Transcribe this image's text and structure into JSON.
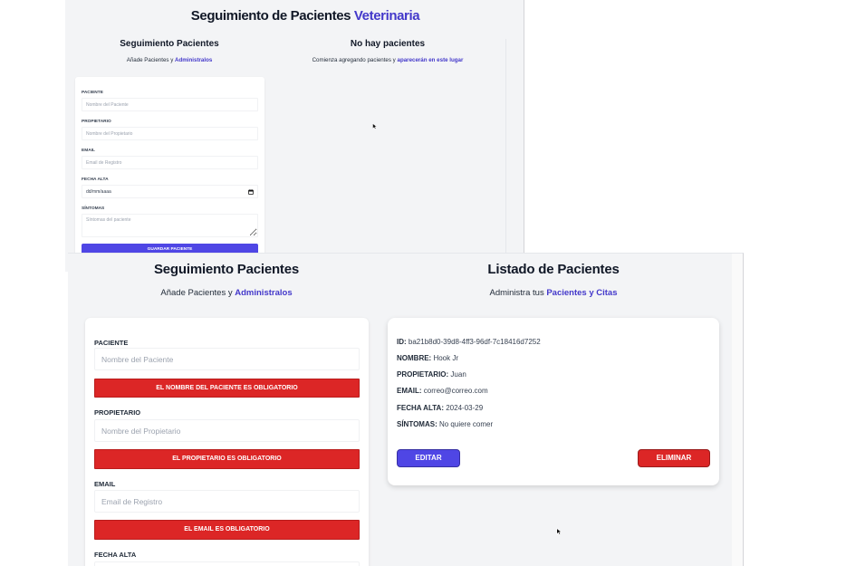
{
  "colors": {
    "accent": "#4338ca",
    "primary_button": "#4f46e5",
    "danger": "#dc2626",
    "page_background": "#f3f4f6",
    "card_background": "#ffffff"
  },
  "icons": {
    "date_picker": "calendar-icon",
    "pointer": "mouse-cursor-icon"
  },
  "top_screen": {
    "header": {
      "title": "Seguimiento de Pacientes",
      "title_accent": "Veterinaria"
    },
    "form_section": {
      "heading": "Seguimiento Pacientes",
      "subtitle": "Añade Pacientes y",
      "subtitle_accent": "Administralos"
    },
    "list_section": {
      "heading": "No hay pacientes",
      "subtitle": "Comienza agregando pacientes y",
      "subtitle_accent": "aparecerán en este lugar"
    },
    "form": {
      "fields": [
        {
          "label": "PACIENTE",
          "placeholder": "Nombre del Paciente"
        },
        {
          "label": "PROPIETARIO",
          "placeholder": "Nombre del Propietario"
        },
        {
          "label": "EMAIL",
          "placeholder": "Email de Registro"
        },
        {
          "label": "FECHA ALTA",
          "value": "dd/mm/aaaa"
        },
        {
          "label": "SÍNTOMAS",
          "placeholder": "Síntomas del paciente"
        }
      ],
      "submit_label": "GUARDAR PACIENTE"
    }
  },
  "bottom_screen": {
    "form_section": {
      "heading": "Seguimiento Pacientes",
      "subtitle": "Añade Pacientes y",
      "subtitle_accent": "Administralos"
    },
    "list_section": {
      "heading": "Listado de Pacientes",
      "subtitle": "Administra tus",
      "subtitle_accent": "Pacientes y Citas"
    },
    "form": {
      "fields": [
        {
          "label": "PACIENTE",
          "placeholder": "Nombre del Paciente",
          "error": "EL NOMBRE DEL PACIENTE ES OBLIGATORIO"
        },
        {
          "label": "PROPIETARIO",
          "placeholder": "Nombre del Propietario",
          "error": "EL PROPIETARIO ES OBLIGATORIO"
        },
        {
          "label": "EMAIL",
          "placeholder": "Email de Registro",
          "error": "EL EMAIL ES OBLIGATORIO"
        },
        {
          "label": "FECHA ALTA"
        }
      ]
    },
    "patient_card": {
      "fields": [
        {
          "label": "ID:",
          "value": "ba21b8d0-39d8-4ff3-96df-7c18416d7252"
        },
        {
          "label": "NOMBRE:",
          "value": "Hook Jr"
        },
        {
          "label": "PROPIETARIO:",
          "value": "Juan"
        },
        {
          "label": "EMAIL:",
          "value": "correo@correo.com"
        },
        {
          "label": "FECHA ALTA:",
          "value": "2024-03-29"
        },
        {
          "label": "SÍNTOMAS:",
          "value": "No quiere comer"
        }
      ],
      "edit_label": "EDITAR",
      "delete_label": "ELIMINAR"
    }
  }
}
